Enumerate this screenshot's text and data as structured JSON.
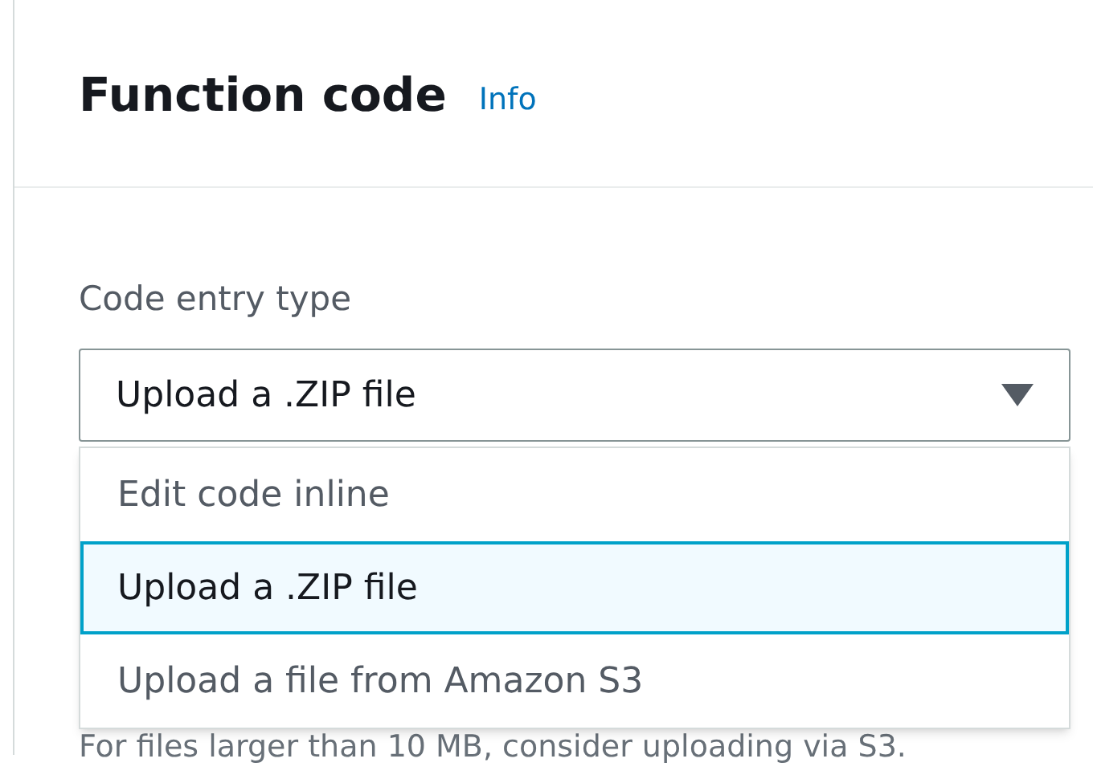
{
  "header": {
    "title": "Function code",
    "info_link": "Info"
  },
  "field": {
    "label": "Code entry type",
    "value": "Upload a .ZIP file",
    "expanded": true,
    "options": [
      {
        "label": "Edit code inline",
        "selected": false
      },
      {
        "label": "Upload a .ZIP file",
        "selected": true
      },
      {
        "label": "Upload a file from Amazon S3",
        "selected": false
      }
    ],
    "hint": "For files larger than 10 MB, consider uploading via S3."
  }
}
